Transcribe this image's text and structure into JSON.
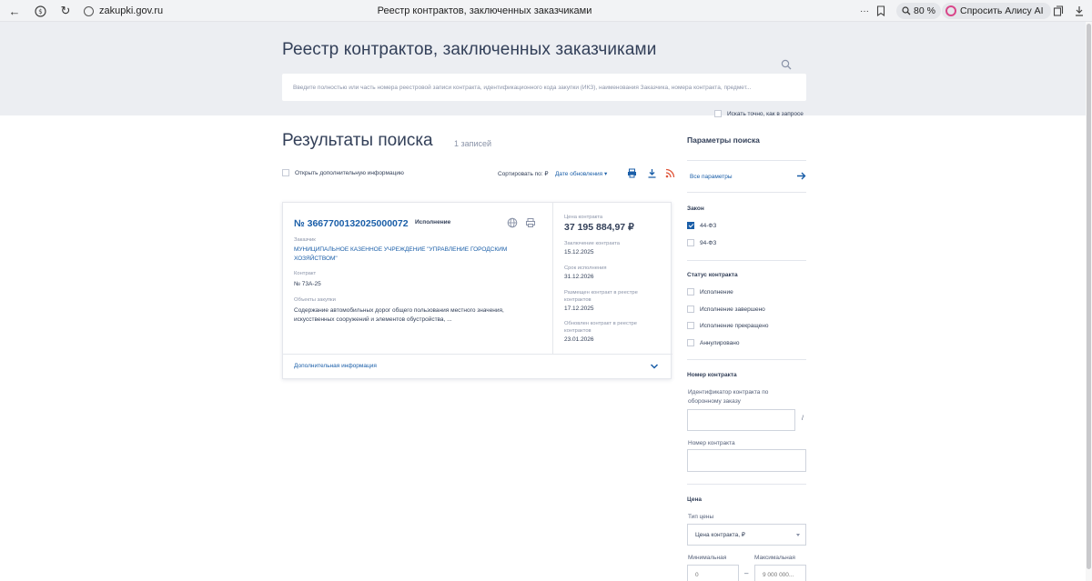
{
  "browser": {
    "url": "zakupki.gov.ru",
    "tab_title": "Реестр контрактов, заключенных заказчиками",
    "zoom": "80 %",
    "alice_label": "Спросить Алису AI"
  },
  "header": {
    "title": "Реестр контрактов, заключенных заказчиками",
    "search_placeholder": "Введите полностью или часть номера реестровой записи контракта, идентификационного кода закупки (ИКЗ), наименования Заказчика, номера контракта, предмет...",
    "exact_match_label": "Искать точно, как в запросе"
  },
  "results": {
    "title": "Результаты поиска",
    "count": "1 записей",
    "show_more_label": "Открыть дополнительную информацию",
    "sort_label": "Сортировать по: ₽",
    "sort_value": "Дате обновления"
  },
  "card": {
    "number": "№ 3667700132025000072",
    "status": "Исполнение",
    "customer_label": "Заказчик",
    "customer_line1": "МУНИЦИПАЛЬНОЕ КАЗЕННОЕ УЧРЕЖДЕНИЕ \"УПРАВЛЕНИЕ ГОРОДСКИМ",
    "customer_line2": "ХОЗЯЙСТВОМ\"",
    "contract_label": "Контракт",
    "contract_value": "№ 73А-25",
    "objects_label": "Объекты закупки",
    "objects_line1": "Содержание автомобильных дорог общего пользования местного значения,",
    "objects_line2": "искусственных сооружений и элементов обустройства, ...",
    "price_label": "Цена контракта",
    "price_value": "37 195 884,97 ₽",
    "concluded_label": "Заключение контракта",
    "concluded_value": "15.12.2025",
    "term_label": "Срок исполнения",
    "term_value": "31.12.2026",
    "placed_label_1": "Размещен контракт в реестре",
    "placed_label_2": "контрактов",
    "placed_value": "17.12.2025",
    "updated_label_1": "Обновлен контракт в реестре",
    "updated_label_2": "контрактов",
    "updated_value": "23.01.2026",
    "more_info": "Дополнительная информация"
  },
  "sidebar": {
    "title": "Параметры поиска",
    "all_params": "Все параметры",
    "law_title": "Закон",
    "laws": [
      {
        "label": "44-ФЗ",
        "checked": true
      },
      {
        "label": "94-ФЗ",
        "checked": false
      }
    ],
    "status_title": "Статус контракта",
    "statuses": [
      {
        "label": "Исполнение"
      },
      {
        "label": "Исполнение завершено"
      },
      {
        "label": "Исполнение прекращено"
      },
      {
        "label": "Аннулировано"
      }
    ],
    "number_title": "Номер контракта",
    "defense_id_label_1": "Идентификатор контракта по",
    "defense_id_label_2": "оборонному заказу",
    "contract_number_label": "Номер контракта",
    "price_title": "Цена",
    "price_type_label": "Тип цены",
    "price_type_value": "Цена контракта, ₽",
    "min_label": "Минимальная",
    "max_label": "Максимальная",
    "min_placeholder": "0",
    "max_placeholder": "9 000 000..."
  }
}
